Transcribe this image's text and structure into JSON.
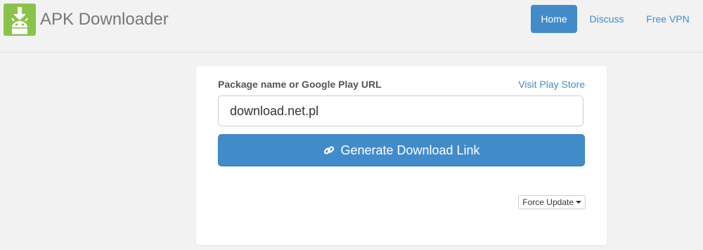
{
  "brand": {
    "title": "APK Downloader",
    "logo_icon": "android-download-icon",
    "logo_color": "#8bc34a"
  },
  "nav": {
    "items": [
      {
        "label": "Home",
        "active": true
      },
      {
        "label": "Discuss",
        "active": false
      },
      {
        "label": "Free VPN",
        "active": false
      }
    ]
  },
  "form": {
    "label": "Package name or Google Play URL",
    "visit_link": "Visit Play Store",
    "input_value": "download.net.pl",
    "generate_label": "Generate Download Link",
    "generate_icon": "link-icon",
    "force_update_label": "Force Update"
  },
  "colors": {
    "primary": "#428bca",
    "background": "#f2f2f2",
    "card": "#ffffff"
  }
}
